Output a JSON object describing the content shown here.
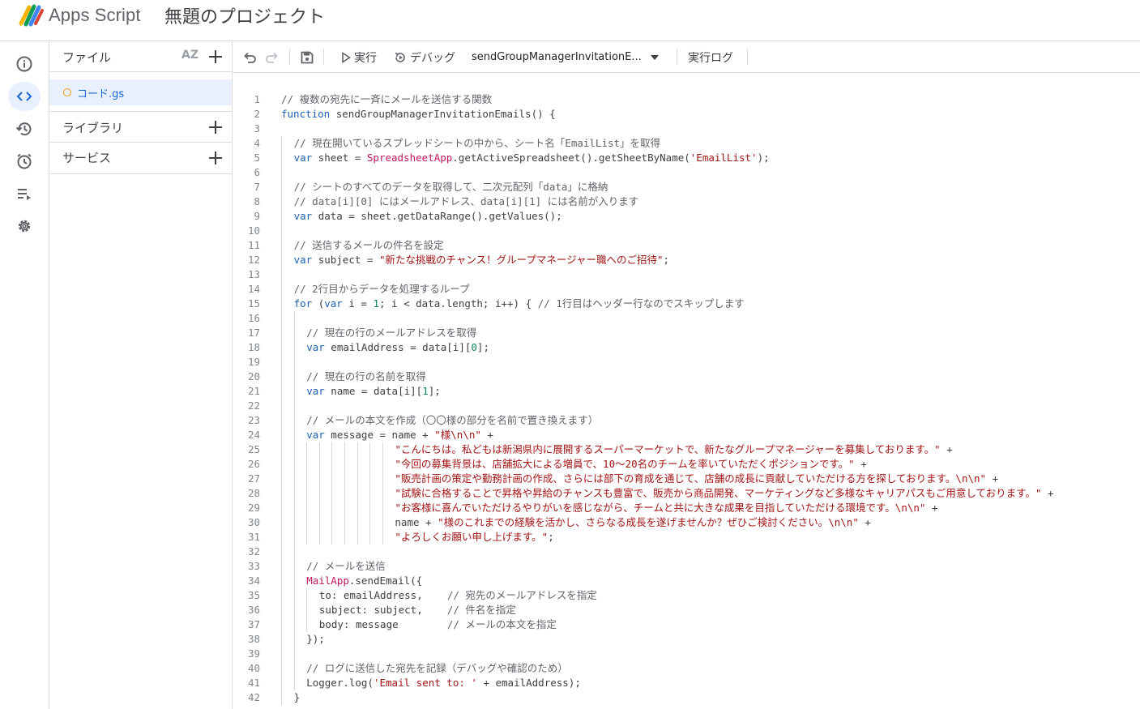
{
  "header": {
    "app_name": "Apps Script",
    "project_title": "無題のプロジェクト"
  },
  "rail": {
    "items": [
      {
        "name": "overview",
        "icon": "info-icon",
        "active": false
      },
      {
        "name": "editor",
        "icon": "code-icon",
        "active": true
      },
      {
        "name": "triggers-history",
        "icon": "history-icon",
        "active": false
      },
      {
        "name": "triggers",
        "icon": "alarm-icon",
        "active": false
      },
      {
        "name": "executions",
        "icon": "executions-icon",
        "active": false
      },
      {
        "name": "settings",
        "icon": "gear-icon",
        "active": false
      }
    ]
  },
  "files_panel": {
    "files_label": "ファイル",
    "sort_label": "AZ",
    "file_name": "コード.gs",
    "libraries_label": "ライブラリ",
    "services_label": "サービス"
  },
  "toolbar": {
    "run_label": "実行",
    "debug_label": "デバッグ",
    "function_name": "sendGroupManagerInvitationE...",
    "log_label": "実行ログ"
  },
  "editor": {
    "lines": [
      {
        "n": "1",
        "i": 0,
        "t": [
          [
            "c",
            "// 複数の宛先に一斉にメールを送信する関数"
          ]
        ]
      },
      {
        "n": "2",
        "i": 0,
        "t": [
          [
            "k",
            "function"
          ],
          [
            "p",
            " sendGroupManagerInvitationEmails() {"
          ]
        ]
      },
      {
        "n": "3",
        "i": 0,
        "t": []
      },
      {
        "n": "4",
        "i": 1,
        "t": [
          [
            "c",
            "// 現在開いているスプレッドシートの中から、シート名「EmailList」を取得"
          ]
        ]
      },
      {
        "n": "5",
        "i": 1,
        "t": [
          [
            "k",
            "var"
          ],
          [
            "p",
            " sheet = "
          ],
          [
            "x",
            "SpreadsheetApp"
          ],
          [
            "p",
            ".getActiveSpreadsheet().getSheetByName("
          ],
          [
            "s",
            "'EmailList'"
          ],
          [
            "p",
            ");"
          ]
        ]
      },
      {
        "n": "6",
        "i": 1,
        "t": []
      },
      {
        "n": "7",
        "i": 1,
        "t": [
          [
            "c",
            "// シートのすべてのデータを取得して、二次元配列「data」に格納"
          ]
        ]
      },
      {
        "n": "8",
        "i": 1,
        "t": [
          [
            "c",
            "// data[i][0] にはメールアドレス、data[i][1] には名前が入ります"
          ]
        ]
      },
      {
        "n": "9",
        "i": 1,
        "t": [
          [
            "k",
            "var"
          ],
          [
            "p",
            " data = sheet.getDataRange().getValues();"
          ]
        ]
      },
      {
        "n": "10",
        "i": 1,
        "t": []
      },
      {
        "n": "11",
        "i": 1,
        "t": [
          [
            "c",
            "// 送信するメールの件名を設定"
          ]
        ]
      },
      {
        "n": "12",
        "i": 1,
        "t": [
          [
            "k",
            "var"
          ],
          [
            "p",
            " subject = "
          ],
          [
            "s",
            "\"新たな挑戦のチャンス！グループマネージャー職へのご招待\""
          ],
          [
            "p",
            ";"
          ]
        ]
      },
      {
        "n": "13",
        "i": 1,
        "t": []
      },
      {
        "n": "14",
        "i": 1,
        "t": [
          [
            "c",
            "// 2行目からデータを処理するループ"
          ]
        ]
      },
      {
        "n": "15",
        "i": 1,
        "t": [
          [
            "k",
            "for"
          ],
          [
            "p",
            " ("
          ],
          [
            "k",
            "var"
          ],
          [
            "p",
            " i = "
          ],
          [
            "m",
            "1"
          ],
          [
            "p",
            "; i < data.length; i++) { "
          ],
          [
            "c",
            "// 1行目はヘッダー行なのでスキップします"
          ]
        ]
      },
      {
        "n": "16",
        "i": 2,
        "t": []
      },
      {
        "n": "17",
        "i": 2,
        "t": [
          [
            "c",
            "// 現在の行のメールアドレスを取得"
          ]
        ]
      },
      {
        "n": "18",
        "i": 2,
        "t": [
          [
            "k",
            "var"
          ],
          [
            "p",
            " emailAddress = data[i]["
          ],
          [
            "m",
            "0"
          ],
          [
            "p",
            "];"
          ]
        ]
      },
      {
        "n": "19",
        "i": 2,
        "t": []
      },
      {
        "n": "20",
        "i": 2,
        "t": [
          [
            "c",
            "// 現在の行の名前を取得"
          ]
        ]
      },
      {
        "n": "21",
        "i": 2,
        "t": [
          [
            "k",
            "var"
          ],
          [
            "p",
            " name = data[i]["
          ],
          [
            "m",
            "1"
          ],
          [
            "p",
            "];"
          ]
        ]
      },
      {
        "n": "22",
        "i": 2,
        "t": []
      },
      {
        "n": "23",
        "i": 2,
        "t": [
          [
            "c",
            "// メールの本文を作成（〇〇様の部分を名前で置き換えます）"
          ]
        ]
      },
      {
        "n": "24",
        "i": 2,
        "t": [
          [
            "k",
            "var"
          ],
          [
            "p",
            " message = name + "
          ],
          [
            "s",
            "\"様\\n\\n\""
          ],
          [
            "p",
            " +"
          ]
        ]
      },
      {
        "n": "25",
        "i": 9,
        "t": [
          [
            "s",
            "\"こんにちは。私どもは新潟県内に展開するスーパーマーケットで、新たなグループマネージャーを募集しております。\""
          ],
          [
            "p",
            " +"
          ]
        ]
      },
      {
        "n": "26",
        "i": 9,
        "t": [
          [
            "s",
            "\"今回の募集背景は、店舗拡大による増員で、10〜20名のチームを率いていただくポジションです。\""
          ],
          [
            "p",
            " +"
          ]
        ]
      },
      {
        "n": "27",
        "i": 9,
        "t": [
          [
            "s",
            "\"販売計画の策定や勤務計画の作成、さらには部下の育成を通じて、店舗の成長に貢献していただける方を探しております。\\n\\n\""
          ],
          [
            "p",
            " +"
          ]
        ]
      },
      {
        "n": "28",
        "i": 9,
        "t": [
          [
            "s",
            "\"試験に合格することで昇格や昇給のチャンスも豊富で、販売から商品開発、マーケティングなど多様なキャリアパスもご用意しております。\""
          ],
          [
            "p",
            " +"
          ]
        ]
      },
      {
        "n": "29",
        "i": 9,
        "t": [
          [
            "s",
            "\"お客様に喜んでいただけるやりがいを感じながら、チームと共に大きな成果を目指していただける環境です。\\n\\n\""
          ],
          [
            "p",
            " +"
          ]
        ]
      },
      {
        "n": "30",
        "i": 9,
        "t": [
          [
            "p",
            "name + "
          ],
          [
            "s",
            "\"様のこれまでの経験を活かし、さらなる成長を遂げませんか？ぜひご検討ください。\\n\\n\""
          ],
          [
            "p",
            " +"
          ]
        ]
      },
      {
        "n": "31",
        "i": 9,
        "t": [
          [
            "s",
            "\"よろしくお願い申し上げます。\""
          ],
          [
            "p",
            ";"
          ]
        ]
      },
      {
        "n": "32",
        "i": 2,
        "t": []
      },
      {
        "n": "33",
        "i": 2,
        "t": [
          [
            "c",
            "// メールを送信"
          ]
        ]
      },
      {
        "n": "34",
        "i": 2,
        "t": [
          [
            "x",
            "MailApp"
          ],
          [
            "p",
            ".sendEmail({"
          ]
        ]
      },
      {
        "n": "35",
        "i": 3,
        "t": [
          [
            "p",
            "to: emailAddress,    "
          ],
          [
            "c",
            "// 宛先のメールアドレスを指定"
          ]
        ]
      },
      {
        "n": "36",
        "i": 3,
        "t": [
          [
            "p",
            "subject: subject,    "
          ],
          [
            "c",
            "// 件名を指定"
          ]
        ]
      },
      {
        "n": "37",
        "i": 3,
        "t": [
          [
            "p",
            "body: message        "
          ],
          [
            "c",
            "// メールの本文を指定"
          ]
        ]
      },
      {
        "n": "38",
        "i": 2,
        "t": [
          [
            "p",
            "});"
          ]
        ]
      },
      {
        "n": "39",
        "i": 2,
        "t": []
      },
      {
        "n": "40",
        "i": 2,
        "t": [
          [
            "c",
            "// ログに送信した宛先を記録（デバッグや確認のため）"
          ]
        ]
      },
      {
        "n": "41",
        "i": 2,
        "t": [
          [
            "p",
            "Logger.log("
          ],
          [
            "s",
            "'Email sent to: '"
          ],
          [
            "p",
            " + emailAddress);"
          ]
        ]
      },
      {
        "n": "42",
        "i": 1,
        "t": [
          [
            "p",
            "}"
          ]
        ]
      }
    ]
  }
}
